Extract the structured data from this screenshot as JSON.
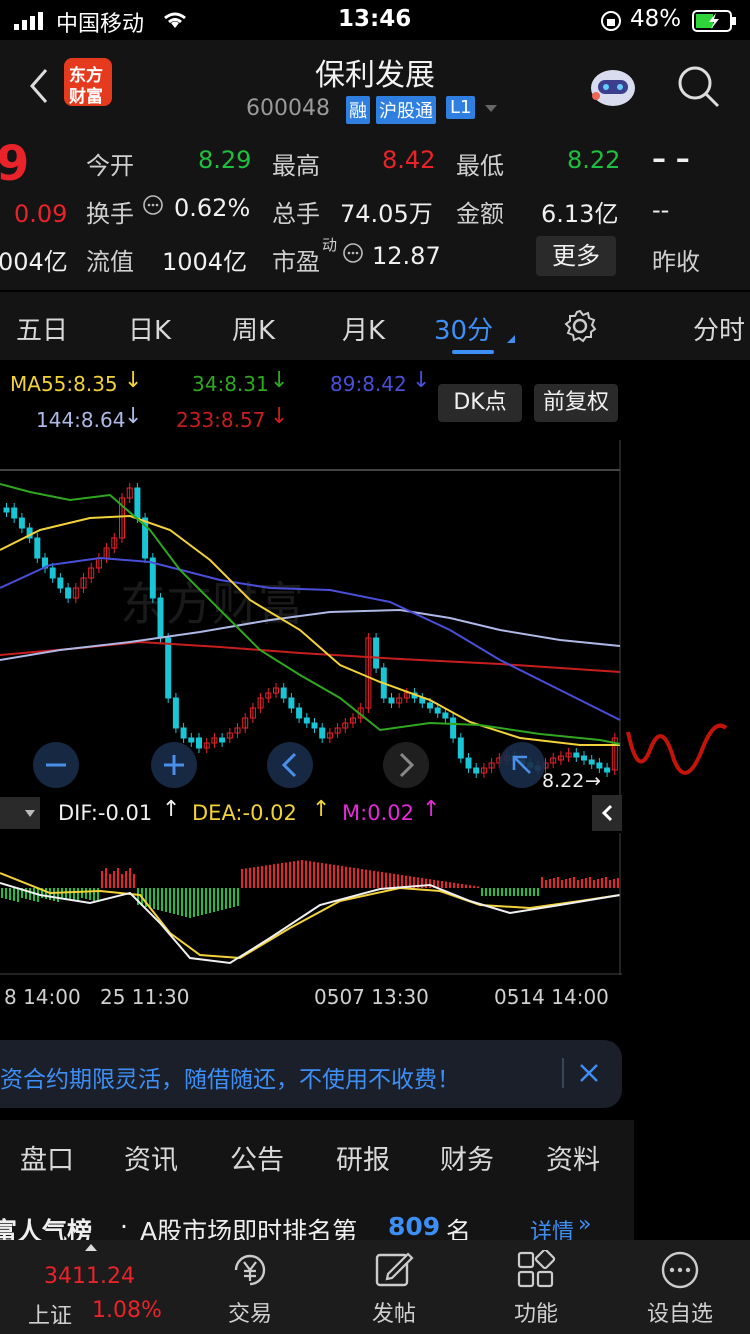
{
  "status_bar": {
    "carrier": "中国移动",
    "time": "13:46",
    "battery": "48%"
  },
  "header": {
    "title": "保利发展",
    "code": "600048",
    "badges": [
      "融",
      "沪股通",
      "L1"
    ],
    "logo_text_1": "东方",
    "logo_text_2": "财富"
  },
  "quote": {
    "price_fragment": "9",
    "change": "0.09",
    "cap_fragment": "004亿",
    "rows": [
      {
        "label": "今开",
        "value": "8.29",
        "label2": "最高",
        "value2": "8.42",
        "label3": "最低",
        "value3": "8.22",
        "extra": "– –"
      },
      {
        "label": "换手",
        "value": "0.62%",
        "label2": "总手",
        "value2": "74.05万",
        "label3": "金额",
        "value3": "6.13亿",
        "extra": "--"
      },
      {
        "label": "流值",
        "value": "1004亿",
        "label2": "市盈",
        "value2": "12.87",
        "label2_sup": "动",
        "extra": "昨收"
      }
    ],
    "more_button": "更多"
  },
  "tabs": {
    "items": [
      "五日",
      "日K",
      "周K",
      "月K",
      "30分",
      "分时"
    ],
    "active_index": 4
  },
  "ma_legend": {
    "ma55": "MA55:8.35",
    "ma34": "34:8.31",
    "ma89": "89:8.42",
    "ma144": "144:8.64",
    "ma233": "233:8.57",
    "dk_button": "DK点",
    "fq_button": "前复权"
  },
  "chart": {
    "last_price_label": "8.22",
    "watermark": "东方财富"
  },
  "macd_legend": {
    "dif": "DIF:-0.01",
    "dea": "DEA:-0.02",
    "m": "M:0.02"
  },
  "time_axis": [
    "8 14:00",
    "25 11:30",
    "0507 13:30",
    "0514 14:00"
  ],
  "banner": {
    "text": "资合约期限灵活，随借随还，不使用不收费！"
  },
  "info_tabs": [
    "盘口",
    "资讯",
    "公告",
    "研报",
    "财务",
    "资料"
  ],
  "ranking": {
    "prefix": "富人气榜",
    "text": "A股市场即时排名第",
    "rank": "809",
    "suffix": "名",
    "link": "详情"
  },
  "tabbar": {
    "index_value": "3411.24",
    "index_name": "上证",
    "index_change": "1.08%",
    "items": [
      "交易",
      "发帖",
      "功能",
      "设自选"
    ]
  },
  "colors": {
    "up": "#e8232a",
    "down": "#1fbf3f",
    "accent": "#3d8ff5",
    "ma55": "#f2d23a",
    "ma34": "#2fa81f",
    "ma89": "#4a4fd8",
    "ma144": "#aeb9e6",
    "ma233": "#c81e1e"
  }
}
